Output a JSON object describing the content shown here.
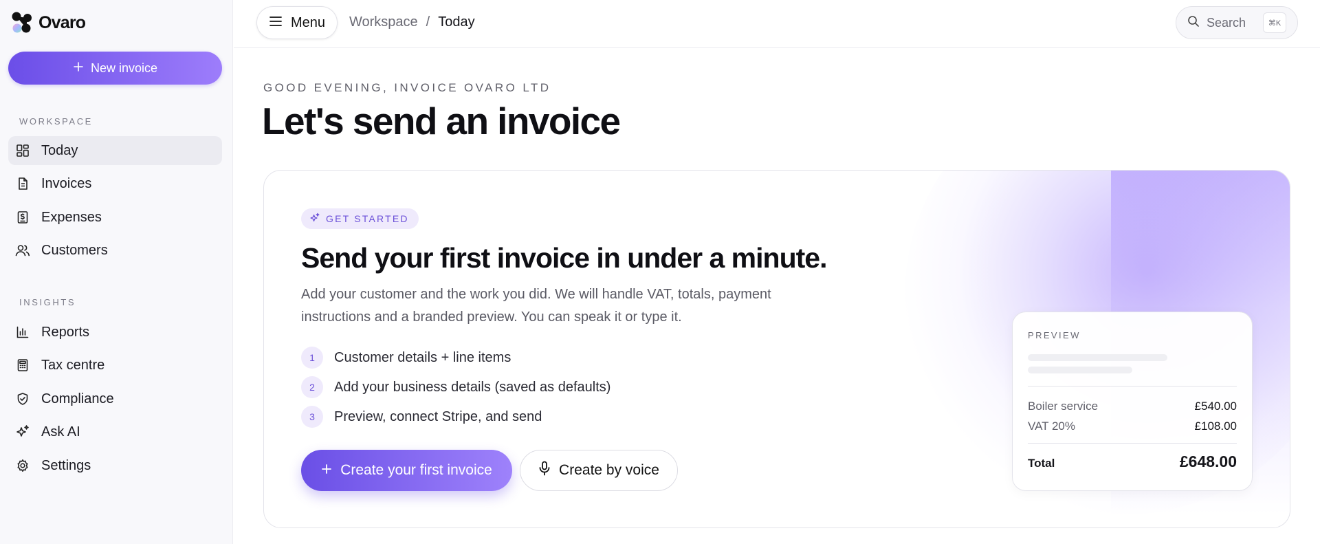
{
  "brand": {
    "name": "Ovaro",
    "accent": "#6b4ee8",
    "accent_light": "#9d7dfb"
  },
  "sidebar": {
    "new_invoice_label": "New invoice",
    "sections": [
      {
        "label": "WORKSPACE"
      },
      {
        "label": "INSIGHTS"
      }
    ],
    "items": [
      {
        "label": "Today",
        "icon": "dashboard-icon",
        "active": true
      },
      {
        "label": "Invoices",
        "icon": "document-icon"
      },
      {
        "label": "Expenses",
        "icon": "receipt-dollar-icon"
      },
      {
        "label": "Customers",
        "icon": "users-icon"
      },
      {
        "label": "Reports",
        "icon": "bar-chart-icon"
      },
      {
        "label": "Tax centre",
        "icon": "calculator-icon"
      },
      {
        "label": "Compliance",
        "icon": "shield-check-icon"
      },
      {
        "label": "Ask AI",
        "icon": "sparkles-icon"
      },
      {
        "label": "Settings",
        "icon": "gear-icon"
      }
    ]
  },
  "topbar": {
    "menu_label": "Menu",
    "breadcrumb": [
      "Workspace",
      "Today"
    ],
    "breadcrumb_sep": "/",
    "search_placeholder": "Search",
    "search_shortcut": "⌘K"
  },
  "main": {
    "greeting": "GOOD EVENING, INVOICE OVARO LTD",
    "headline": "Let's send an invoice",
    "card": {
      "badge": "GET STARTED",
      "title": "Send your first invoice in under a minute.",
      "description": "Add your customer and the work you did. We will handle VAT, totals, payment instructions and a branded preview. You can speak it or type it.",
      "steps": [
        {
          "num": "1",
          "text": "Customer details + line items"
        },
        {
          "num": "2",
          "text": "Add your business details (saved as defaults)"
        },
        {
          "num": "3",
          "text": "Preview, connect Stripe, and send"
        }
      ],
      "cta_label": "Create your first invoice",
      "voice_label": "Create by voice",
      "preview": {
        "label": "PREVIEW",
        "rows": [
          {
            "label": "Boiler service",
            "value": "£540.00"
          },
          {
            "label": "VAT 20%",
            "value": "£108.00"
          }
        ],
        "total_label": "Total",
        "total_value": "£648.00"
      }
    }
  }
}
